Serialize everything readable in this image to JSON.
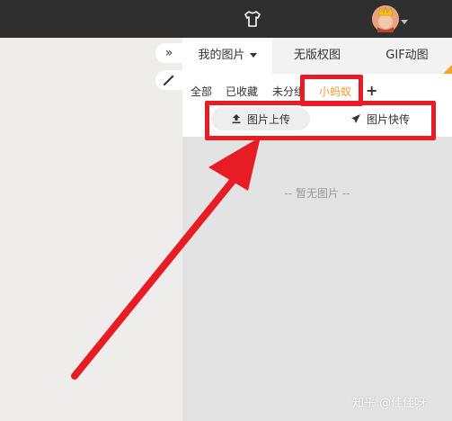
{
  "header": {
    "shirt_icon": "shirt-icon",
    "avatar_icon": "avatar-icon"
  },
  "sidebar_buttons": {
    "expand_glyph": "»",
    "wand_glyph": "🪄"
  },
  "tabs": [
    {
      "label": "我的图片",
      "active": true,
      "has_caret": true
    },
    {
      "label": "无版权图",
      "active": false
    },
    {
      "label": "GIF动图",
      "active": false
    }
  ],
  "categories": [
    "全部",
    "已收藏",
    "未分组",
    "小蚂蚁"
  ],
  "selected_category": "小蚂蚁",
  "add_category": "+",
  "actions": {
    "upload_label": "图片上传",
    "fast_upload_label": "图片快传"
  },
  "empty_message": "-- 暂无图片 --",
  "watermark": "知乎 @佳佳呀",
  "colors": {
    "topbar": "#2f2f2f",
    "annotation_red": "#e81c24",
    "highlight_orange": "#f29b38",
    "corner_orange": "#f5a623"
  }
}
